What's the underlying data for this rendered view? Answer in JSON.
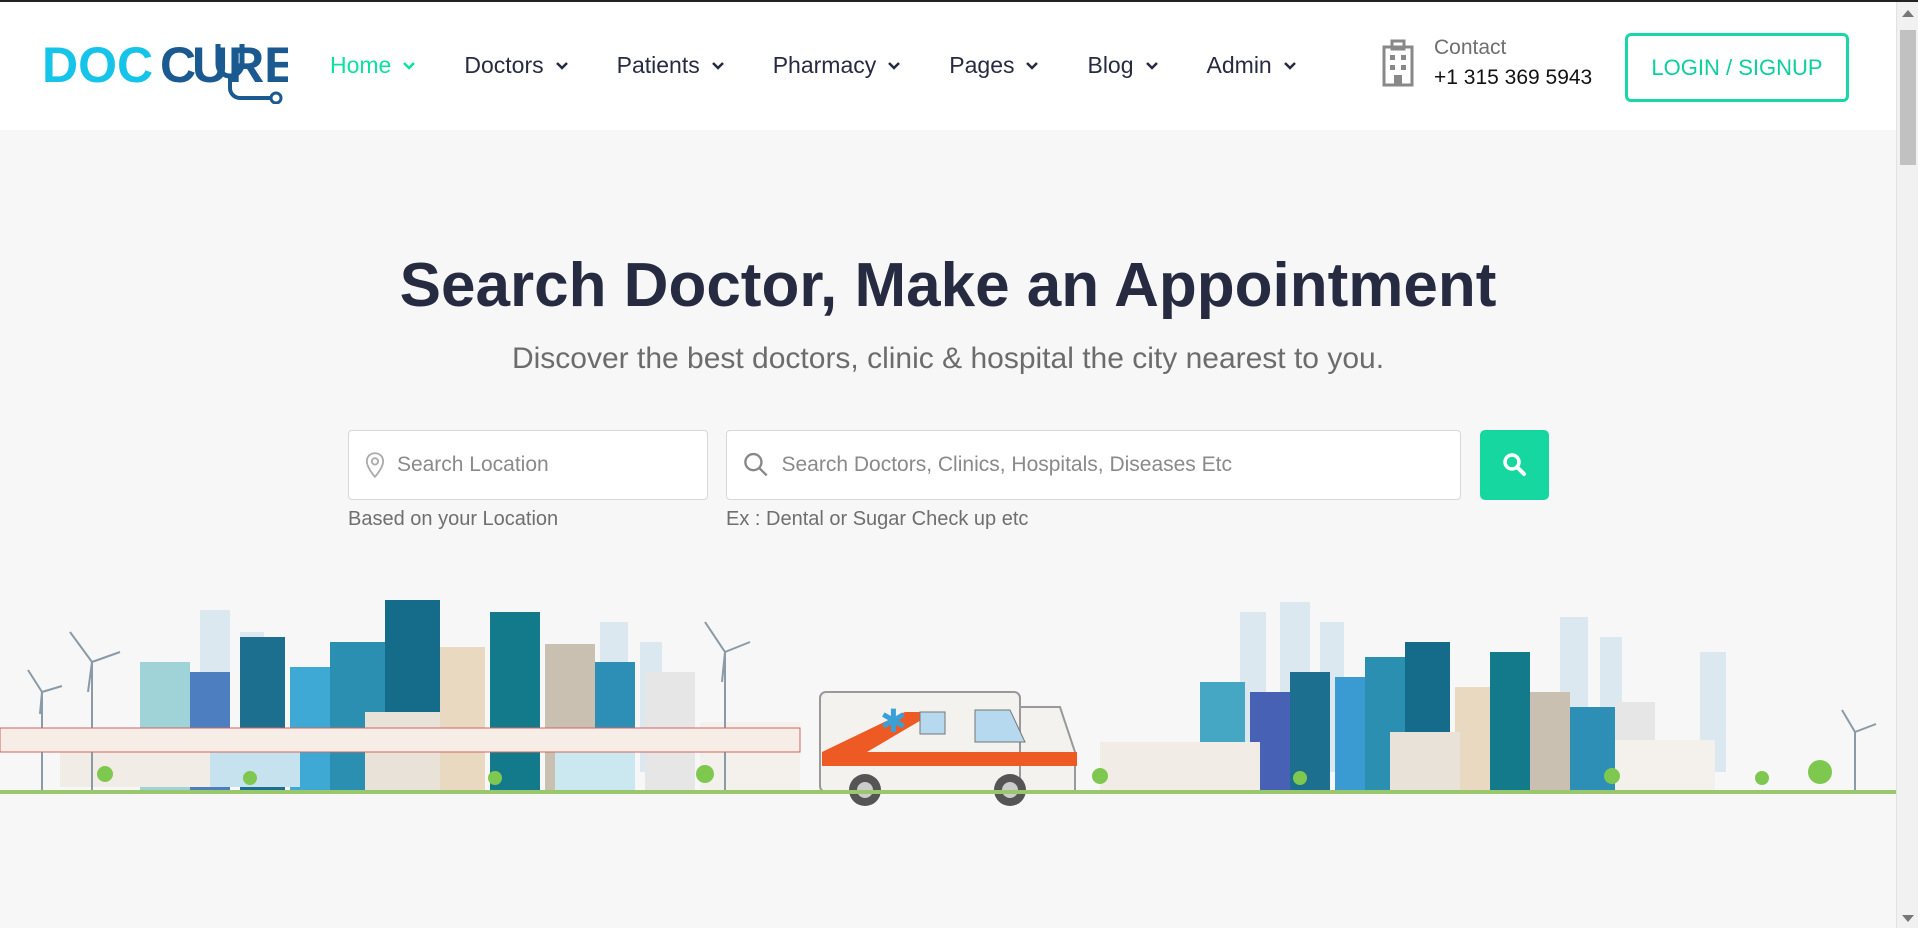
{
  "brand": {
    "logo_text": "DOCCURE"
  },
  "nav": {
    "items": [
      {
        "label": "Home",
        "active": true
      },
      {
        "label": "Doctors",
        "active": false
      },
      {
        "label": "Patients",
        "active": false
      },
      {
        "label": "Pharmacy",
        "active": false
      },
      {
        "label": "Pages",
        "active": false
      },
      {
        "label": "Blog",
        "active": false
      },
      {
        "label": "Admin",
        "active": false
      }
    ]
  },
  "contact": {
    "label": "Contact",
    "phone": "+1 315 369 5943",
    "icon": "hospital-building-icon"
  },
  "login": {
    "label": "LOGIN / SIGNUP"
  },
  "hero": {
    "title": "Search Doctor, Make an Appointment",
    "subtitle": "Discover the best doctors, clinic & hospital the city nearest to you."
  },
  "search": {
    "location_placeholder": "Search Location",
    "location_hint": "Based on your Location",
    "query_placeholder": "Search Doctors, Clinics, Hospitals, Diseases Etc",
    "query_hint": "Ex : Dental or Sugar Check up etc",
    "button_icon": "search-icon"
  },
  "colors": {
    "accent": "#0de0a0",
    "heading": "#272b41",
    "brand_blue": "#1b5a90",
    "brand_cyan": "#15c4e8"
  }
}
